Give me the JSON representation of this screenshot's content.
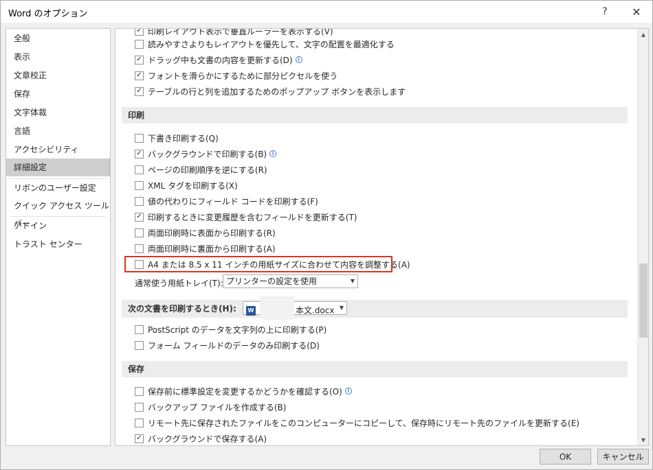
{
  "window": {
    "title": "Word のオプション",
    "help_glyph": "?",
    "close_glyph": "✕"
  },
  "nav": {
    "items": [
      {
        "label": "全般"
      },
      {
        "label": "表示"
      },
      {
        "label": "文章校正"
      },
      {
        "label": "保存"
      },
      {
        "label": "文字体裁"
      },
      {
        "label": "言語"
      },
      {
        "label": "アクセシビリティ"
      },
      {
        "label": "詳細設定",
        "selected": true
      },
      {
        "label": "リボンのユーザー設定"
      },
      {
        "label": "クイック アクセス ツール バー"
      },
      {
        "label": "アドイン"
      },
      {
        "label": "トラスト センター"
      }
    ]
  },
  "display_options": [
    {
      "label": "印刷レイアウト表示で垂直ルーラーを表示する(V)",
      "checked": true
    },
    {
      "label": "読みやすさよりもレイアウトを優先して、文字の配置を最適化する",
      "checked": false
    },
    {
      "label": "ドラッグ中も文書の内容を更新する(D)",
      "checked": true,
      "info": true
    },
    {
      "label": "フォントを滑らかにするために部分ピクセルを使う",
      "checked": true
    },
    {
      "label": "テーブルの行と列を追加するためのポップアップ ボタンを表示します",
      "checked": true
    }
  ],
  "print_section": {
    "title": "印刷",
    "options": [
      {
        "label": "下書き印刷する(Q)",
        "checked": false
      },
      {
        "label": "バックグラウンドで印刷する(B)",
        "checked": true,
        "info": true
      },
      {
        "label": "ページの印刷順序を逆にする(R)",
        "checked": false
      },
      {
        "label": "XML タグを印刷する(X)",
        "checked": false
      },
      {
        "label": "値の代わりにフィールド コードを印刷する(F)",
        "checked": false
      },
      {
        "label": "印刷するときに変更履歴を含むフィールドを更新する(T)",
        "checked": true
      },
      {
        "label": "両面印刷時に表面から印刷する(R)",
        "checked": false
      },
      {
        "label": "両面印刷時に裏面から印刷する(A)",
        "checked": false
      },
      {
        "label": "A4 または 8.5 x 11 インチの用紙サイズに合わせて内容を調整する(A)",
        "checked": false
      }
    ],
    "tray_label": "通常使う用紙トレイ(T):",
    "tray_value": "プリンターの設定を使用"
  },
  "print_doc_section": {
    "title": "次の文書を印刷するとき(H):",
    "doc_icon": "W",
    "doc_name": "本文.docx",
    "options": [
      {
        "label": "PostScript のデータを文字列の上に印刷する(P)",
        "checked": false
      },
      {
        "label": "フォーム フィールドのデータのみ印刷する(D)",
        "checked": false
      }
    ]
  },
  "save_section": {
    "title": "保存",
    "options": [
      {
        "label": "保存前に標準設定を変更するかどうかを確認する(O)",
        "checked": false,
        "info": true
      },
      {
        "label": "バックアップ ファイルを作成する(B)",
        "checked": false
      },
      {
        "label": "リモート先に保存されたファイルをこのコンピューターにコピーして、保存時にリモート先のファイルを更新する(E)",
        "checked": false
      },
      {
        "label": "バックグラウンドで保存する(A)",
        "checked": true
      }
    ]
  },
  "footer": {
    "ok_label": "OK",
    "cancel_label": "キャンセル"
  },
  "colors": {
    "highlight_border": "#d9341f",
    "info_icon": "#3b7bd0"
  }
}
